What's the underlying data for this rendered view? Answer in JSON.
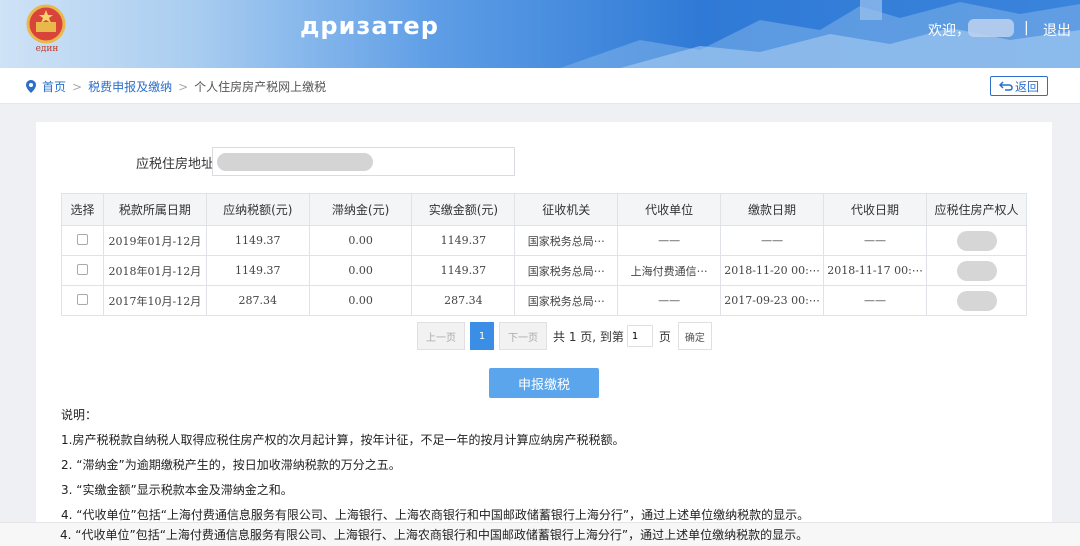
{
  "header": {
    "site_title": "дризатер",
    "emblem_motto": "един",
    "welcome": "欢迎，",
    "separator": "|",
    "logout": "退出"
  },
  "breadcrumb": {
    "home": "首页",
    "sep": ">",
    "section": "税费申报及缴纳",
    "current": "个人住房房产税网上缴税",
    "back": "返回"
  },
  "form": {
    "address_label": "应税住房地址"
  },
  "table": {
    "headers": [
      "选择",
      "税款所属日期",
      "应纳税额(元)",
      "滞纳金(元)",
      "实缴金额(元)",
      "征收机关",
      "代收单位",
      "缴款日期",
      "代收日期",
      "应税住房产权人"
    ],
    "rows": [
      [
        "",
        "2019年01月-12月",
        "1149.37",
        "0.00",
        "1149.37",
        "国家税务总局⋯",
        "——",
        "——",
        "——",
        ""
      ],
      [
        "",
        "2018年01月-12月",
        "1149.37",
        "0.00",
        "1149.37",
        "国家税务总局⋯",
        "上海付费通信⋯",
        "2018-11-20 00:⋯",
        "2018-11-17 00:⋯",
        ""
      ],
      [
        "",
        "2017年10月-12月",
        "287.34",
        "0.00",
        "287.34",
        "国家税务总局⋯",
        "——",
        "2017-09-23 00:⋯",
        "——",
        ""
      ]
    ]
  },
  "pager": {
    "prev": "上一页",
    "current": "1",
    "next": "下一页",
    "total_text": "共 1 页, 到第",
    "goto_value": "1",
    "page_unit": "页",
    "confirm": "确定"
  },
  "submit_label": "申报缴税",
  "notes": {
    "title": "说明：",
    "items": [
      "1.房产税税款自纳税人取得应税住房产权的次月起计算，按年计征，不足一年的按月计算应纳房产税税额。",
      "2. “滞纳金”为逾期缴税产生的，按日加收滞纳税款的万分之五。",
      "3. “实缴金额”显示税款本金及滞纳金之和。",
      "4. “代收单位”包括“上海付费通信息服务有限公司、上海银行、上海农商银行和中国邮政储蓄银行上海分行”，通过上述单位缴纳税款的显示。"
    ],
    "duplicate": "4. “代收单位”包括“上海付费通信息服务有限公司、上海银行、上海农商银行和中国邮政储蓄银行上海分行”，通过上述单位缴纳税款的显示。"
  },
  "icons": {
    "emblem": "national-emblem-icon",
    "location": "location-pin-icon",
    "back": "return-arrow-icon"
  },
  "colors": {
    "header_blue": "#2f7ad6",
    "link_blue": "#2b6fc9",
    "primary_button": "#5aa5ec",
    "page_active": "#3a8ee6"
  }
}
